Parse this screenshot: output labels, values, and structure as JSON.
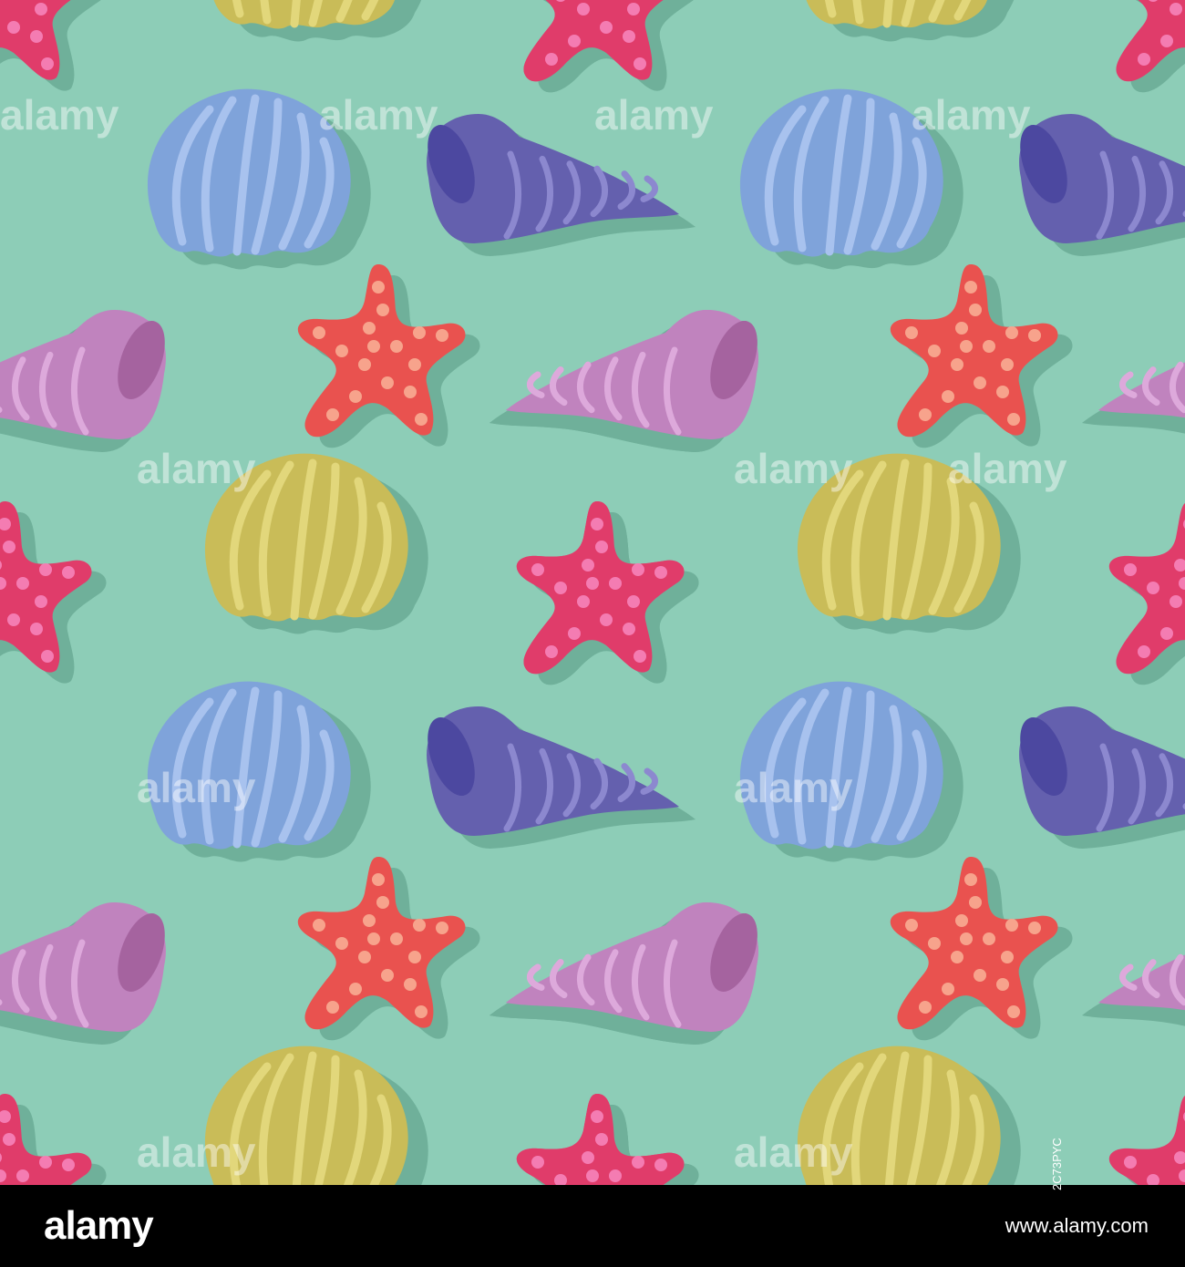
{
  "colors": {
    "background": "#8DCDB7",
    "shadow": "#6FB09A",
    "yellow_shell": "#C9BC58",
    "yellow_rib": "#E2D77B",
    "blue_shell": "#7FA3DA",
    "blue_rib": "#A8C2EE",
    "purple_cone": "#6460AE",
    "purple_rib": "#8C88CF",
    "purple_mouth": "#4C48A0",
    "pink_cone": "#C083BE",
    "pink_rib": "#DDA9DB",
    "pink_mouth": "#A5639F",
    "magenta_star": "#E03C6A",
    "magenta_dot": "#F47CB2",
    "coral_star": "#E9524F",
    "coral_dot": "#F7A38C",
    "footer_bg": "#000000",
    "footer_text": "#FFFFFF"
  },
  "tile_contents": [
    "yellow-scallop-shell",
    "blue-scallop-shell",
    "purple-cone-shell",
    "pink-cone-shell",
    "magenta-starfish",
    "coral-starfish"
  ],
  "watermark": {
    "text": "alamy"
  },
  "footer": {
    "logo": "alamy",
    "image_id": "2C73PYC",
    "site": "www.alamy.com"
  }
}
